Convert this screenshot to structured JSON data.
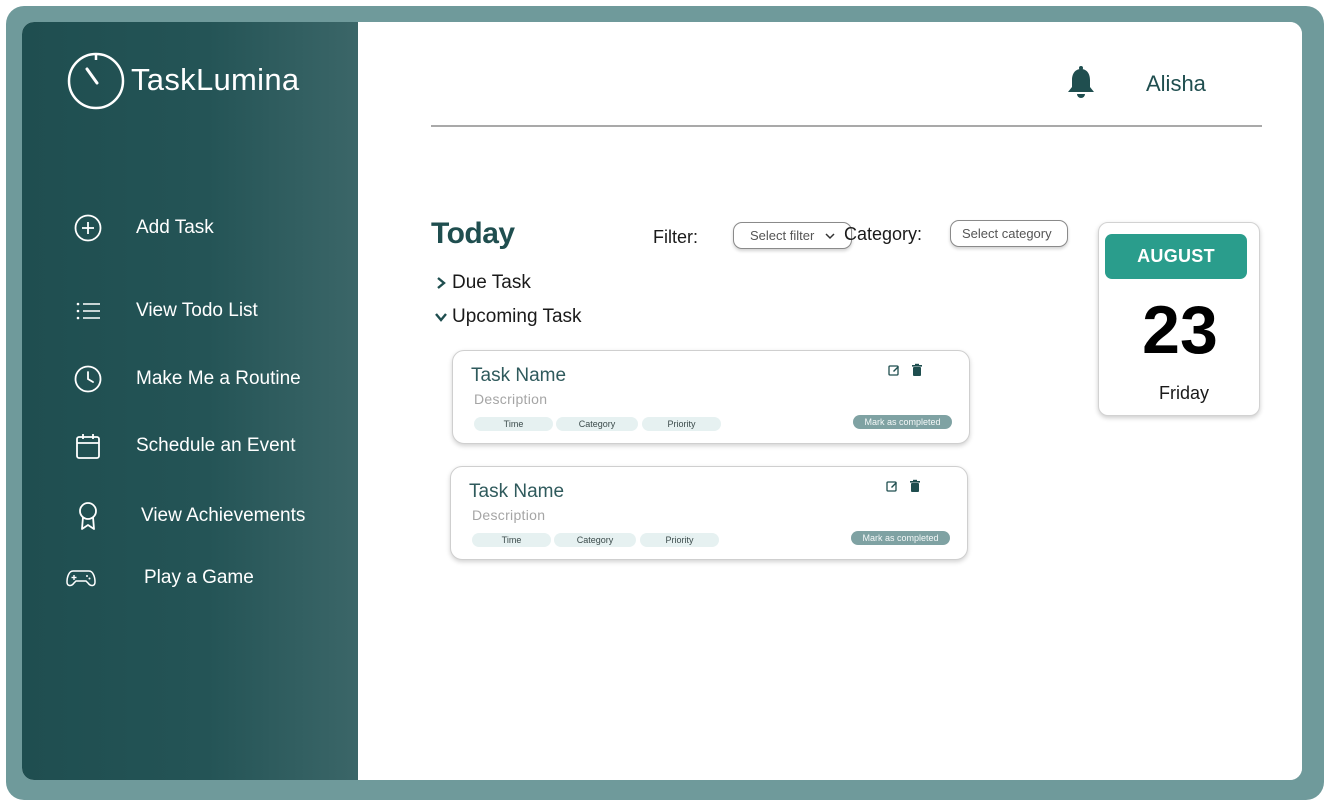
{
  "app": {
    "name": "TaskLumina"
  },
  "sidebar": {
    "items": [
      {
        "label": "Add Task",
        "icon": "plus-circle-icon"
      },
      {
        "label": "View Todo List",
        "icon": "list-icon"
      },
      {
        "label": "Make Me a Routine",
        "icon": "clock-icon"
      },
      {
        "label": "Schedule an Event",
        "icon": "calendar-icon"
      },
      {
        "label": "View Achievements",
        "icon": "award-icon"
      },
      {
        "label": "Play a Game",
        "icon": "gamepad-icon"
      }
    ]
  },
  "header": {
    "username": "Alisha",
    "notification_icon": "bell-icon"
  },
  "main": {
    "title": "Today",
    "filter": {
      "label": "Filter:",
      "placeholder": "Select filter"
    },
    "category": {
      "label": "Category:",
      "placeholder": "Select category"
    },
    "sections": [
      {
        "label": "Due Task",
        "state": "collapsed"
      },
      {
        "label": "Upcoming Task",
        "state": "expanded"
      }
    ],
    "tasks": [
      {
        "name": "Task Name",
        "description": "Description",
        "time": "Time",
        "category": "Category",
        "priority": "Priority",
        "action": "Mark as completed"
      },
      {
        "name": "Task Name",
        "description": "Description",
        "time": "Time",
        "category": "Category",
        "priority": "Priority",
        "action": "Mark as completed"
      }
    ]
  },
  "calendar": {
    "month": "AUGUST",
    "day": "23",
    "weekday": "Friday"
  },
  "colors": {
    "sidebar": "#245456",
    "frame": "#6f9a9b",
    "accent": "#2a9d8c",
    "badge": "#7fa2a3",
    "tag": "#e6f1f1"
  }
}
